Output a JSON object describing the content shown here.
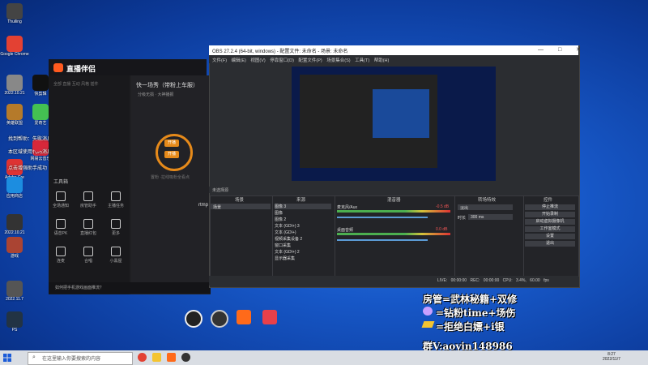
{
  "desktop_icons": [
    {
      "label": "Thuiling",
      "color": "#444"
    },
    {
      "label": "Google Chrome",
      "color": "#e34133"
    },
    {
      "label": "2022.10.21",
      "color": "#888"
    },
    {
      "label": "快剪辑",
      "color": "#111"
    },
    {
      "label": "英雄联盟",
      "color": "#b57a2a"
    },
    {
      "label": "爱奇艺",
      "color": "#44c052"
    },
    {
      "label": "网易云音乐",
      "color": "#d8283a"
    },
    {
      "label": "Adobe Cre",
      "color": "#d33"
    },
    {
      "label": "应用商店",
      "color": "#1c8de0"
    },
    {
      "label": "2022.10.21",
      "color": "#333"
    },
    {
      "label": "游戏",
      "color": "#a43"
    },
    {
      "label": "2022.11.7",
      "color": "#555"
    },
    {
      "label": "PS",
      "color": "#234"
    }
  ],
  "notification": {
    "line1": "找到帮助：失败消息",
    "line2": "本区域使用代码消息和礼物消息",
    "line3": "点击增强助手成功"
  },
  "app": {
    "name": "直播伴侣",
    "tabs": "全部  直播  互动  风格  插件",
    "stream_title": "快一场秀（带粉上车服）",
    "stream_sub": "分级无损 · 大神播报",
    "start_btn": "开播",
    "hint": "置粉 ·拉线吸粉全看点",
    "tools_title": "工具箱",
    "tools": [
      "全场通知",
      "房管助手",
      "主播任务",
      "语音PK",
      "直播红包",
      "更多",
      "连麦",
      "合唱",
      "小黑屋"
    ],
    "bottom_text": "如何把手机游戏画面推流？",
    "mid_label": "rtmp"
  },
  "obs": {
    "title": "OBS 27.2.4 (64-bit, windows) - 配置文件: 未命名 - 场景: 未命名",
    "window_buttons": "— □ ✕",
    "menu": "文件(F) 编辑(E) 视图(V) 停靠窗口(D) 配置文件(P) 场景集合(S) 工具(T) 帮助(H)",
    "scene_bar": "未选择源",
    "docks": {
      "scenes": "场景",
      "sources": "来源",
      "mixer": "混音器",
      "transitions": "转场特效",
      "controls": "控件"
    },
    "scene_item": "场景",
    "sources": [
      "图像 3",
      "图像",
      "图像 2",
      "文本 (GDI+) 3",
      "文本 (GDI+)",
      "视频采集设备 2",
      "窗口采集",
      "文本 (GDI+) 2",
      "显示器采集"
    ],
    "mixer": [
      {
        "name": "麦克风/Aux",
        "db": "-0.5 dB"
      },
      {
        "name": "桌面音频",
        "db": "0.0 dB"
      }
    ],
    "transition": {
      "type": "淡出",
      "duration_label": "时长",
      "duration": "300 ms"
    },
    "controls": [
      "停止推流",
      "开始录制",
      "启动虚拟摄像机",
      "工作室模式",
      "设置",
      "退出"
    ],
    "status": "LIVE: 00:00:00  REC: 00:00:00  CPU: 3.4%, 60.00 fps"
  },
  "overlay": {
    "line1": "房管=武林秘籍+双修",
    "line2": "=钻粉time+场伤",
    "line3": "=拒绝白嫖+i银",
    "line4": "群V:aoyin148986"
  },
  "taskbar": {
    "search_placeholder": "在这里输入你要搜索的内容",
    "time": "8:27",
    "date": "2022/11/7"
  }
}
